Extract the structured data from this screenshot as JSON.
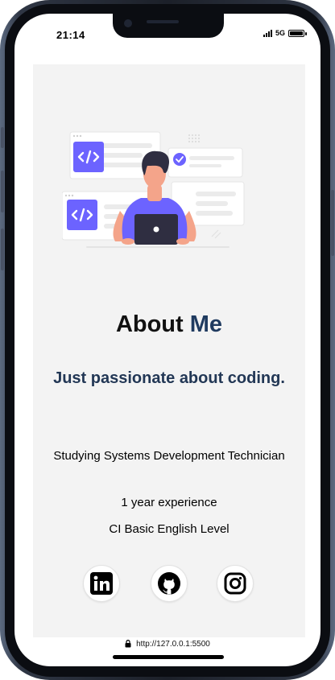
{
  "status_bar": {
    "time": "21:14",
    "network": "5G"
  },
  "about": {
    "heading_first": "About",
    "heading_second": "Me",
    "tagline": "Just passionate about coding.",
    "details": [
      "Studying Systems Development Technician",
      "1 year experience",
      "CI Basic English Level"
    ]
  },
  "socials": [
    {
      "name": "linkedin",
      "icon": "linkedin-icon"
    },
    {
      "name": "github",
      "icon": "github-icon"
    },
    {
      "name": "instagram",
      "icon": "instagram-icon"
    }
  ],
  "browser": {
    "url": "http://127.0.0.1:5500"
  },
  "colors": {
    "accent_purple": "#6c63ff",
    "heading_dark": "#1f3a5f",
    "skin": "#f4a48a",
    "hair": "#2f2e41",
    "panel_background": "#f3f3f3"
  }
}
